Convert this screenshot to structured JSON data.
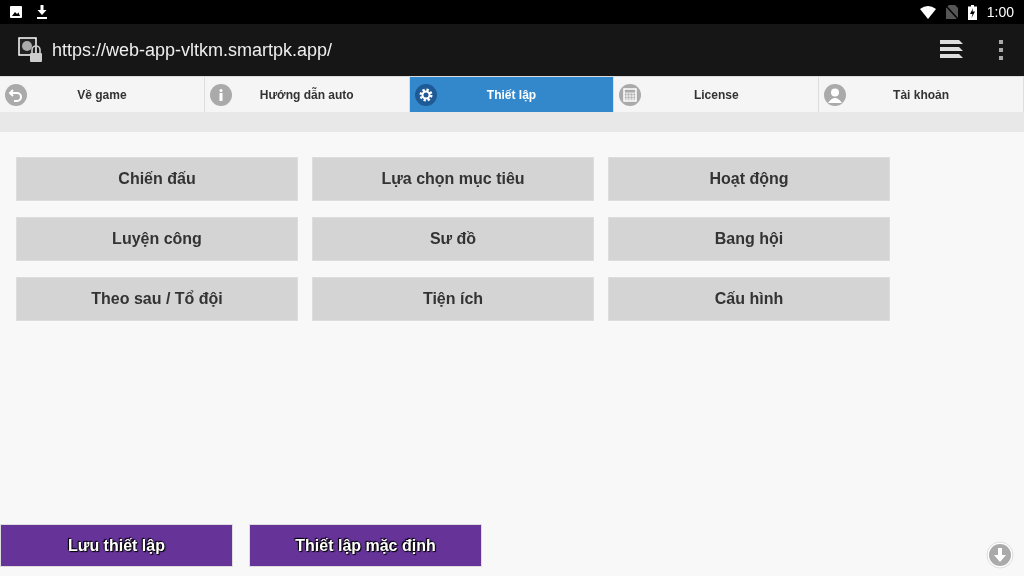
{
  "status_bar": {
    "time": "1:00"
  },
  "address_bar": {
    "url": "https://web-app-vltkm.smartpk.app/"
  },
  "tabs": [
    {
      "label": "Về game",
      "selected": false
    },
    {
      "label": "Hướng dẫn auto",
      "selected": false
    },
    {
      "label": "Thiết lập",
      "selected": true
    },
    {
      "label": "License",
      "selected": false
    },
    {
      "label": "Tài khoản",
      "selected": false
    }
  ],
  "settings_buttons": [
    "Chiến đấu",
    "Lựa chọn mục tiêu",
    "Hoạt động",
    "Luyện công",
    "Sư đồ",
    "Bang hội",
    "Theo sau / Tổ đội",
    "Tiện ích",
    "Cấu hình"
  ],
  "footer_buttons": [
    "Lưu thiết lập",
    "Thiết lập mặc định"
  ]
}
